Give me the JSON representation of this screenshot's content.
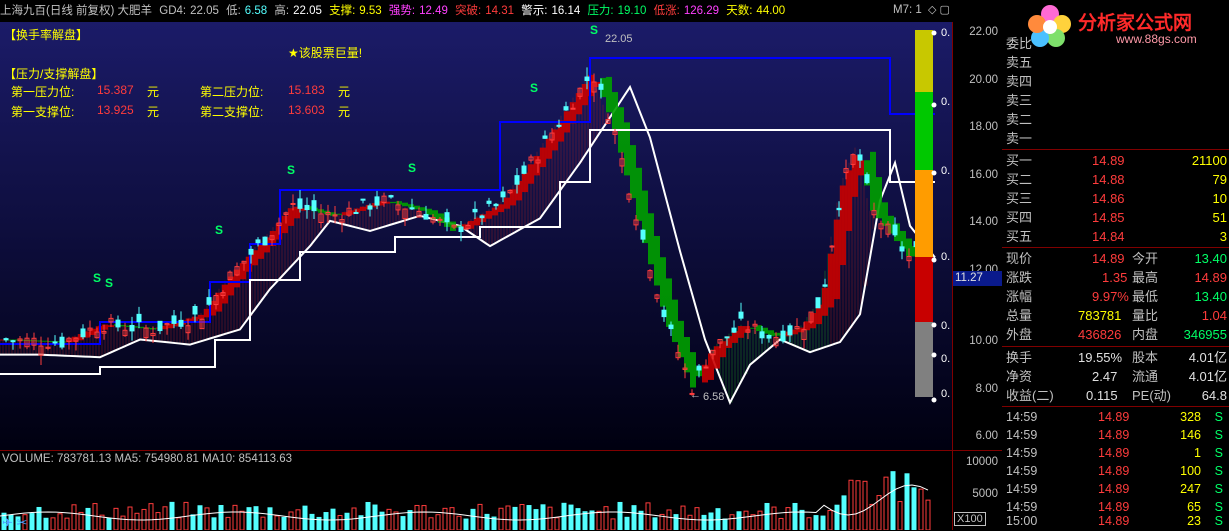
{
  "topbar": {
    "title": "上海九百(日线 前复权) 大肥羊",
    "gd4_label": "GD4:",
    "gd4": "22.05",
    "low_label": "低:",
    "low": "6.58",
    "high_label": "高:",
    "high": "22.05",
    "support_label": "支撑:",
    "support": "9.53",
    "strength_label": "强势:",
    "strength": "12.49",
    "breakout_label": "突破:",
    "breakout": "14.31",
    "warn_label": "警示:",
    "warn": "16.14",
    "pressure_label": "压力:",
    "pressure": "19.10",
    "lowrise_label": "低涨:",
    "lowrise": "126.29",
    "days_label": "天数:",
    "days": "44.00",
    "m7": "M7: 1"
  },
  "overlay": {
    "turnover_title": "【换手率解盘】",
    "big_volume": "★该股票巨量!",
    "ps_title": "【压力/支撑解盘】",
    "p1_label": "第一压力位:",
    "p1": "15.387",
    "p2_label": "第二压力位:",
    "p2": "15.183",
    "s1_label": "第一支撑位:",
    "s1": "13.925",
    "s2_label": "第二支撑位:",
    "s2": "13.603",
    "unit": "元",
    "high_mark": "22.05",
    "low_mark": "6.58",
    "s_marks": [
      "S",
      "S",
      "S",
      "S",
      "S",
      "S",
      "S",
      "S"
    ]
  },
  "price_axis": [
    "22.00",
    "20.00",
    "18.00",
    "16.00",
    "14.00",
    "12.00",
    "10.00",
    "8.00",
    "6.00"
  ],
  "current_price_tag": "11.27",
  "side_labels": [
    "0.",
    "0.",
    "0.",
    "0.",
    "0.",
    "0.",
    "0.",
    "0.",
    "0."
  ],
  "vol_bar": {
    "text": "VOLUME: 783781.13  MA5: 754980.81  MA10: 854113.63"
  },
  "vol_axis": [
    "10000",
    "5000"
  ],
  "vol_unit": "X100",
  "logo": {
    "name": "分析家公式网",
    "url": "www.88gs.com"
  },
  "orderbook": {
    "ratio_label": "委比",
    "asks": [
      {
        "label": "卖五",
        "price": "",
        "vol": ""
      },
      {
        "label": "卖四",
        "price": "",
        "vol": ""
      },
      {
        "label": "卖三",
        "price": "",
        "vol": ""
      },
      {
        "label": "卖二",
        "price": "",
        "vol": ""
      },
      {
        "label": "卖一",
        "price": "",
        "vol": ""
      }
    ],
    "bids": [
      {
        "label": "买一",
        "price": "14.89",
        "vol": "21100"
      },
      {
        "label": "买二",
        "price": "14.88",
        "vol": "79"
      },
      {
        "label": "买三",
        "price": "14.86",
        "vol": "10"
      },
      {
        "label": "买四",
        "price": "14.85",
        "vol": "51"
      },
      {
        "label": "买五",
        "price": "14.84",
        "vol": "3"
      }
    ]
  },
  "quote": [
    {
      "l1": "现价",
      "v1": "14.89",
      "l2": "今开",
      "v2": "13.40"
    },
    {
      "l1": "涨跌",
      "v1": "1.35",
      "l2": "最高",
      "v2": "14.89"
    },
    {
      "l1": "涨幅",
      "v1": "9.97%",
      "l2": "最低",
      "v2": "13.40"
    },
    {
      "l1": "总量",
      "v1": "783781",
      "l2": "量比",
      "v2": "1.04"
    },
    {
      "l1": "外盘",
      "v1": "436826",
      "l2": "内盘",
      "v2": "346955"
    }
  ],
  "fund": [
    {
      "l1": "换手",
      "v1": "19.55%",
      "l2": "股本",
      "v2": "4.01亿"
    },
    {
      "l1": "净资",
      "v1": "2.47",
      "l2": "流通",
      "v2": "4.01亿"
    },
    {
      "l1": "收益(二)",
      "v1": "0.115",
      "l2": "PE(动)",
      "v2": "64.8"
    }
  ],
  "ticks": [
    {
      "t": "14:59",
      "p": "14.89",
      "v": "328",
      "s": "S"
    },
    {
      "t": "14:59",
      "p": "14.89",
      "v": "146",
      "s": "S"
    },
    {
      "t": "14:59",
      "p": "14.89",
      "v": "1",
      "s": "S"
    },
    {
      "t": "14:59",
      "p": "14.89",
      "v": "100",
      "s": "S"
    },
    {
      "t": "14:59",
      "p": "14.89",
      "v": "247",
      "s": "S"
    },
    {
      "t": "14:59",
      "p": "14.89",
      "v": "65",
      "s": "S"
    },
    {
      "t": "15:00",
      "p": "14.89",
      "v": "23",
      "s": "S"
    }
  ],
  "colors": {
    "up": "#ff3c3c",
    "down": "#54ffff",
    "ma": "#ffffff",
    "band_up": "#c80000",
    "band_dn": "#00a000",
    "level": "#0000ff"
  }
}
